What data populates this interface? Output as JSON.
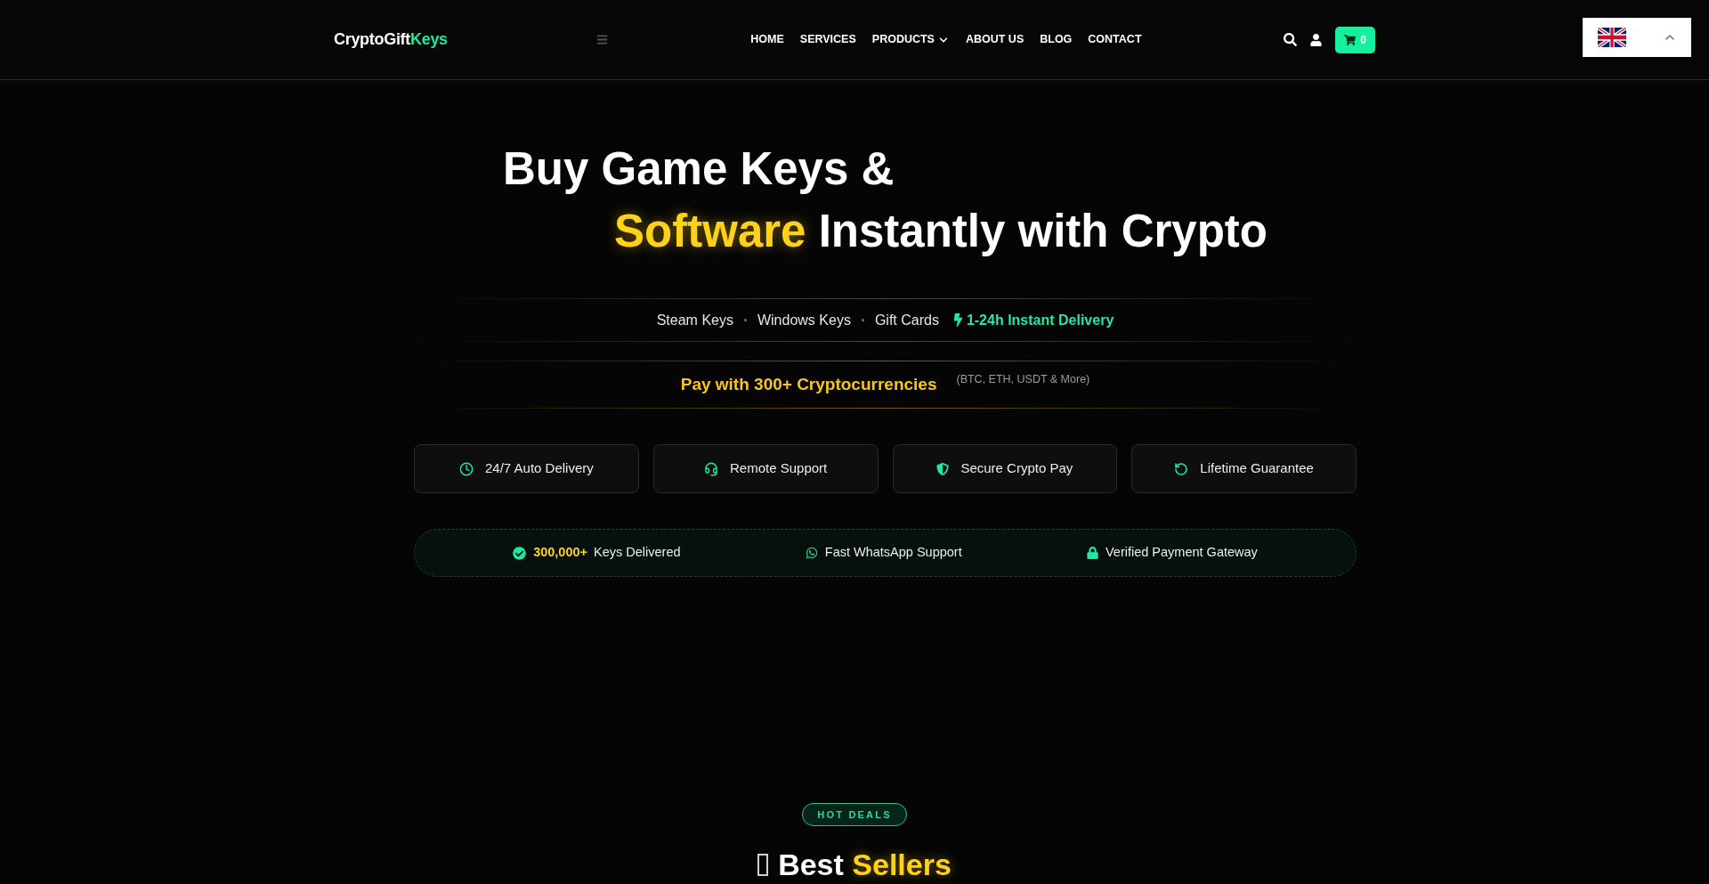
{
  "header": {
    "logo": {
      "text": "CryptoGift",
      "accent": "Keys"
    },
    "nav": [
      {
        "label": "HOME",
        "dropdown": false
      },
      {
        "label": "SERVICES",
        "dropdown": false
      },
      {
        "label": "PRODUCTS",
        "dropdown": true
      },
      {
        "label": "ABOUT US",
        "dropdown": false
      },
      {
        "label": "BLOG",
        "dropdown": false
      },
      {
        "label": "CONTACT",
        "dropdown": false
      }
    ],
    "cart": {
      "count": "0"
    }
  },
  "hero": {
    "headline": {
      "line_1": "Buy Game Keys &",
      "highlight": "Software",
      "line_2": "Instantly with Crypto"
    },
    "categories": [
      "Steam Keys",
      "Windows Keys",
      "Gift Cards"
    ],
    "delivery": "1-24h Instant Delivery",
    "payment": {
      "text": "Pay with 300+ Cryptocurrencies",
      "note": "(BTC, ETH, USDT & More)"
    },
    "features": [
      "24/7 Auto Delivery",
      "Remote Support",
      "Secure Crypto Pay",
      "Lifetime Guarantee"
    ],
    "stats": [
      {
        "highlight": "300,000+",
        "label": "Keys Delivered"
      },
      {
        "label": "Fast WhatsApp Support"
      },
      {
        "label": "Verified Payment Gateway"
      }
    ]
  },
  "best_sellers": {
    "badge": "HOT DEALS",
    "title": "Best",
    "highlight": "Sellers"
  }
}
